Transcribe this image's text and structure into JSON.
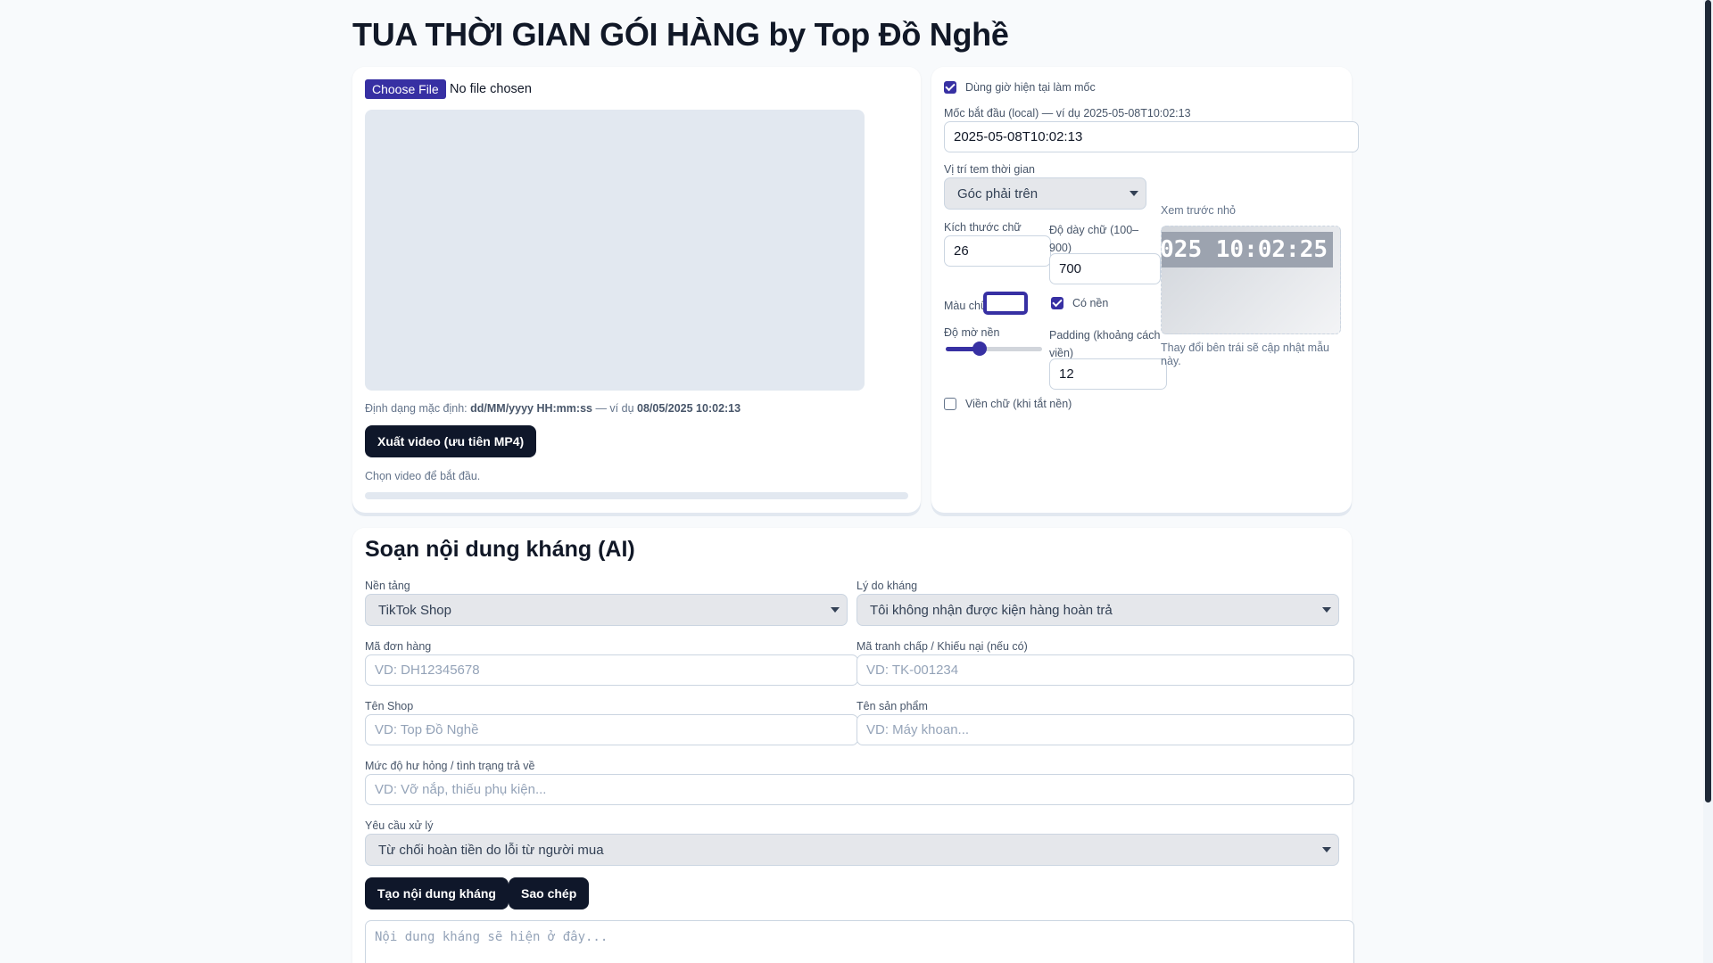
{
  "app": {
    "title": "TUA THỜI GIAN GÓI HÀNG by Top Đồ Nghề"
  },
  "video": {
    "choose_file_label": "Choose File",
    "file_status": "No file chosen",
    "format_prefix": "Định dạng mặc định: ",
    "format_value": "dd/MM/yyyy HH:mm:ss",
    "format_mid": " — ví dụ ",
    "format_example": "08/05/2025 10:02:13",
    "export_button": "Xuất video (ưu tiên MP4)",
    "status": "Chọn video để bắt đầu.",
    "progress": 0
  },
  "settings": {
    "use_current_time_label": "Dùng giờ hiện tại làm mốc",
    "use_current_time_checked": true,
    "start_label": "Mốc bắt đầu (local) — ví dụ 2025-05-08T10:02:13",
    "start_value": "2025-05-08T10:02:13",
    "position_label": "Vị trí tem thời gian",
    "position_value": "Góc phải trên",
    "font_size_label": "Kích thước chữ",
    "font_size_value": "26",
    "font_weight_label": "Độ dày chữ (100–900)",
    "font_weight_value": "700",
    "text_color_label": "Màu chữ",
    "text_color": "#3730a3",
    "has_bg_label": "Có nền",
    "has_bg_checked": true,
    "bg_opacity_label": "Độ mờ nền",
    "bg_opacity_value": 0.35,
    "padding_label": "Padding (khoảng cách viền)",
    "padding_value": "12",
    "stroke_label": "Viền chữ (khi tắt nền)",
    "stroke_checked": false,
    "preview_label": "Xem trước nhỏ",
    "preview_text": "025 10:02:25",
    "preview_hint": "Thay đổi bên trái sẽ cập nhật mẫu này."
  },
  "complaint": {
    "heading": "Soạn nội dung kháng (AI)",
    "platform_label": "Nền tảng",
    "platform_value": "TikTok Shop",
    "reason_label": "Lý do kháng",
    "reason_value": "Tôi không nhận được kiện hàng hoàn trả",
    "order_label": "Mã đơn hàng",
    "order_placeholder": "VD: DH12345678",
    "dispute_label": "Mã tranh chấp / Khiếu nại (nếu có)",
    "dispute_placeholder": "VD: TK-001234",
    "shop_label": "Tên Shop",
    "shop_placeholder": "VD: Top Đồ Nghề",
    "product_label": "Tên sản phẩm",
    "product_placeholder": "VD: Máy khoan...",
    "damage_label": "Mức độ hư hỏng / tình trạng trả về",
    "damage_placeholder": "VD: Vỡ nắp, thiếu phụ kiện...",
    "request_label": "Yêu cầu xử lý",
    "request_value": "Từ chối hoàn tiền do lỗi từ người mua",
    "generate_button": "Tạo nội dung kháng",
    "copy_button": "Sao chép",
    "output_placeholder": "Nội dung kháng sẽ hiện ở đây..."
  },
  "colors": {
    "accent": "#3730a3",
    "dark_button": "#0f172a",
    "preview_bg": "#9ca3af"
  }
}
